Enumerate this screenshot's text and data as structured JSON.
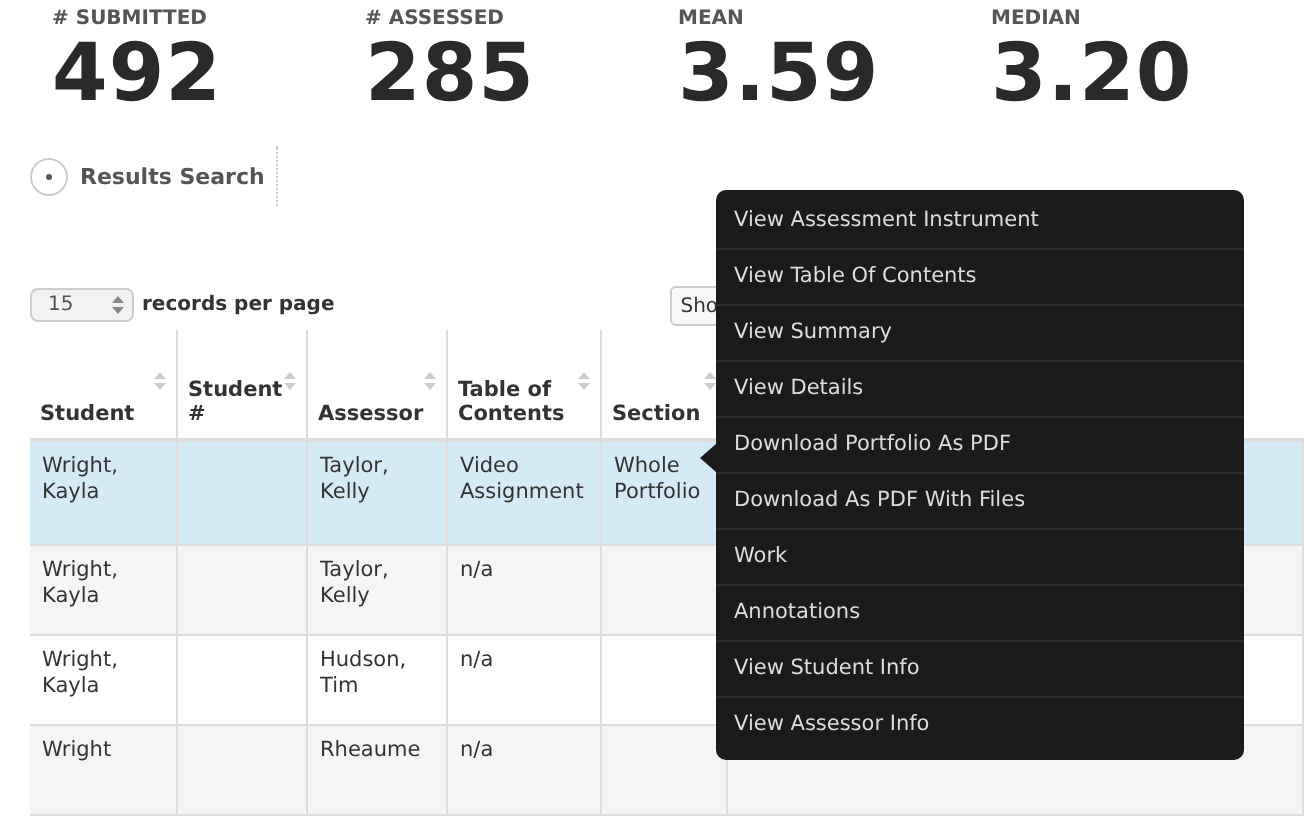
{
  "stats": [
    {
      "label": "# SUBMITTED",
      "value": "492"
    },
    {
      "label": "# ASSESSED",
      "value": "285"
    },
    {
      "label": "MEAN",
      "value": "3.59"
    },
    {
      "label": "MEDIAN",
      "value": "3.20"
    }
  ],
  "results_search": {
    "label": "Results Search"
  },
  "page_size": {
    "value": "15",
    "label": "records per page"
  },
  "toolbar": {
    "buttons": [
      "Sho"
    ]
  },
  "table": {
    "columns": [
      "Student",
      "Student #",
      "Assessor",
      "Table of Contents",
      "Section"
    ],
    "rows": [
      {
        "cells": [
          "Wright, Kayla",
          "",
          "Taylor, Kelly",
          "Video Assignment",
          "Whole Portfolio"
        ],
        "selected": true
      },
      {
        "cells": [
          "Wright, Kayla",
          "",
          "Taylor, Kelly",
          "n/a",
          ""
        ],
        "selected": false
      },
      {
        "cells": [
          "Wright, Kayla",
          "",
          "Hudson, Tim",
          "n/a",
          ""
        ],
        "selected": false
      },
      {
        "cells": [
          "Wright",
          "",
          "Rheaume",
          "n/a",
          ""
        ],
        "selected": false
      }
    ]
  },
  "context_menu": {
    "items": [
      "View Assessment Instrument",
      "View Table Of Contents",
      "View Summary",
      "View Details",
      "Download Portfolio As PDF",
      "Download As PDF With Files",
      "Work",
      "Annotations",
      "View Student Info",
      "View Assessor Info"
    ]
  }
}
